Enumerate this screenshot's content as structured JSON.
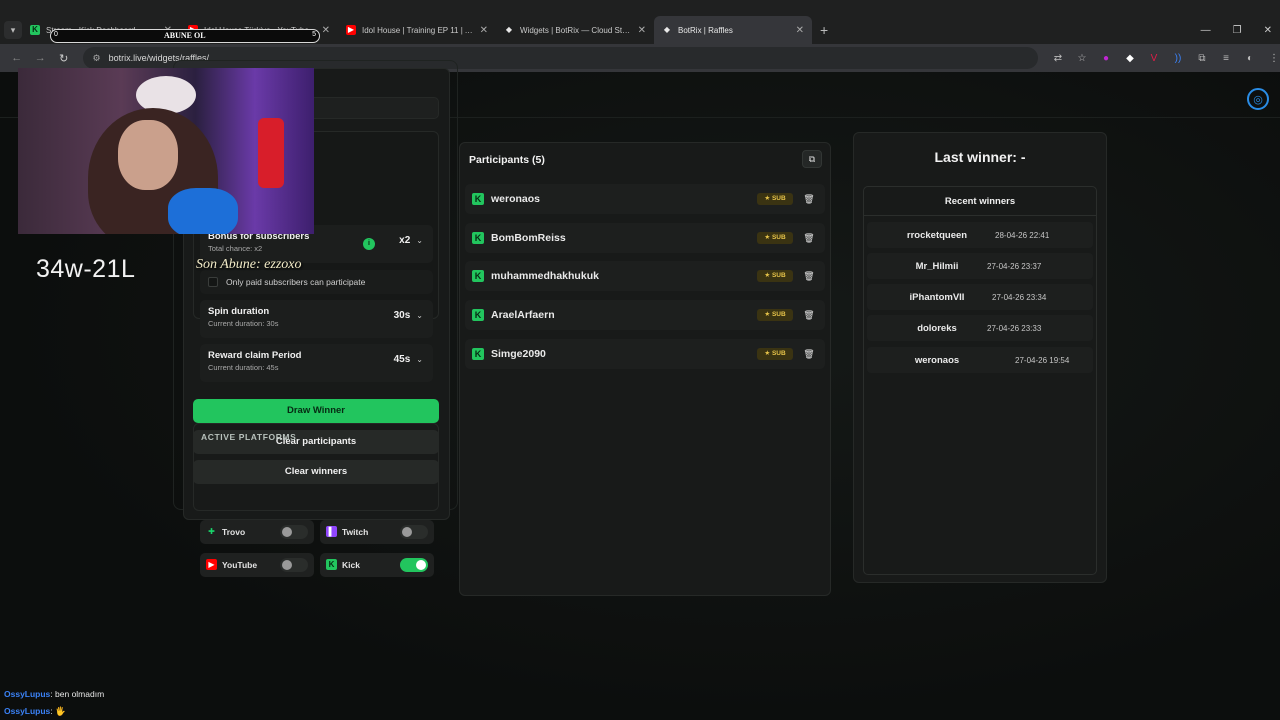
{
  "browser": {
    "tabs": [
      {
        "title": "Stream - Kick Dashboard",
        "favicon": "kick-icon",
        "color": "#22c55e"
      },
      {
        "title": "Idol House Türkiye - YouTube",
        "favicon": "youtube-icon",
        "color": "#ff0000"
      },
      {
        "title": "Idol House | Training EP 11 | A...",
        "favicon": "youtube-icon",
        "color": "#ff0000"
      },
      {
        "title": "Widgets | BotRix — Cloud Strea...",
        "favicon": "botrix-icon",
        "color": "#e8e8e8"
      },
      {
        "title": "BotRix | Raffles",
        "favicon": "botrix-icon",
        "color": "#e8e8e8",
        "active": true
      }
    ],
    "url": "botrix.live/widgets/raffles/"
  },
  "settings": {
    "bonus": {
      "label": "Bonus for subscribers",
      "sub": "Total chance: x2",
      "value": "x2"
    },
    "only_paid": {
      "label": "Only paid subscribers can participate"
    },
    "spin": {
      "label": "Spin duration",
      "sub": "Current duration: 30s",
      "value": "30s"
    },
    "reward": {
      "label": "Reward claim Period",
      "sub": "Current duration: 45s",
      "value": "45s"
    }
  },
  "buttons": {
    "draw": "Draw Winner",
    "clear_participants": "Clear participants",
    "clear_winners": "Clear winners"
  },
  "platforms": {
    "heading": "ACTIVE PLATFORMS",
    "items": [
      {
        "name": "Trovo",
        "enabled": false,
        "color": "#19d66b"
      },
      {
        "name": "Twitch",
        "enabled": false,
        "color": "#9146ff"
      },
      {
        "name": "YouTube",
        "enabled": false,
        "color": "#ff0000"
      },
      {
        "name": "Kick",
        "enabled": true,
        "color": "#22c55e"
      }
    ]
  },
  "participants": {
    "heading": "Participants (5)",
    "badge": "SUB",
    "list": [
      {
        "name": "weronaos"
      },
      {
        "name": "BomBomReiss"
      },
      {
        "name": "muhammedhakhukuk"
      },
      {
        "name": "AraelArfaern"
      },
      {
        "name": "Simge2090"
      }
    ]
  },
  "winners": {
    "last": "Last winner: -",
    "recent_heading": "Recent winners",
    "list": [
      {
        "name": "rrocketqueen",
        "date": "28-04-26 22:41"
      },
      {
        "name": "Mr_Hilmii",
        "date": "27-04-26 23:37"
      },
      {
        "name": "iPhantomVII",
        "date": "27-04-26 23:34"
      },
      {
        "name": "doloreks",
        "date": "27-04-26 23:33"
      },
      {
        "name": "weronaos",
        "date": "27-04-26 19:54"
      }
    ]
  },
  "overlay": {
    "abune_label": "ABUNE OL",
    "abune_start": "0",
    "abune_end": "5",
    "score": "34w-21L",
    "son_abune": "Son Abune: ezzoxo",
    "chat": [
      {
        "user": "OssyLupus",
        "message": ": ben olmadım"
      },
      {
        "user": "OssyLupus",
        "message": ": 🖐"
      }
    ]
  },
  "colors": {
    "accent": "#22c55e",
    "sub_badge": "#e6c34a",
    "chat_user": "#3b82f6"
  }
}
